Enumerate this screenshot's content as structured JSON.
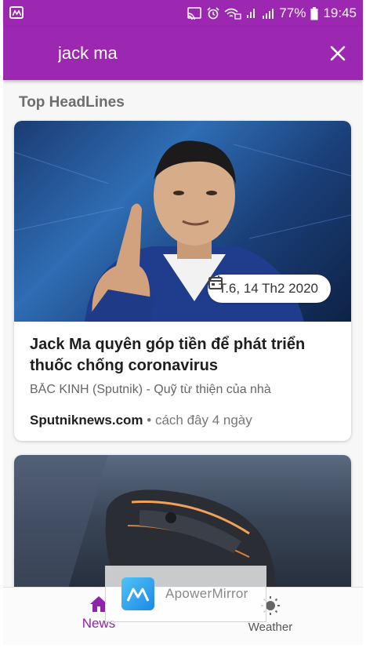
{
  "status_bar": {
    "battery": "77%",
    "time": "19:45",
    "icons": [
      "cast-icon",
      "alarm-icon",
      "wifi-icon",
      "sim-1-icon",
      "signal-icon",
      "battery-icon"
    ]
  },
  "app_bar": {
    "search_value": "jack ma",
    "close_icon": "close-icon"
  },
  "section_title": "Top HeadLines",
  "articles": [
    {
      "date": "T.6, 14 Th2 2020",
      "title": "Jack Ma quyên góp tiền để phát triển thuốc chống coronavirus",
      "description": "BẮC KINH (Sputnik) - Quỹ từ thiện của nhà",
      "source": "Sputniknews.com",
      "age": "• cách đây 4 ngày"
    },
    {
      "image": "gaming-mouse"
    }
  ],
  "overlay": {
    "text": "ApowerMirror"
  },
  "bottom_nav": {
    "items": [
      {
        "label": "News",
        "icon": "home-icon",
        "active": true
      },
      {
        "label": "Weather",
        "icon": "weather-icon",
        "active": false
      }
    ]
  },
  "colors": {
    "primary": "#9c27b0",
    "active_nav": "#8e24aa"
  }
}
